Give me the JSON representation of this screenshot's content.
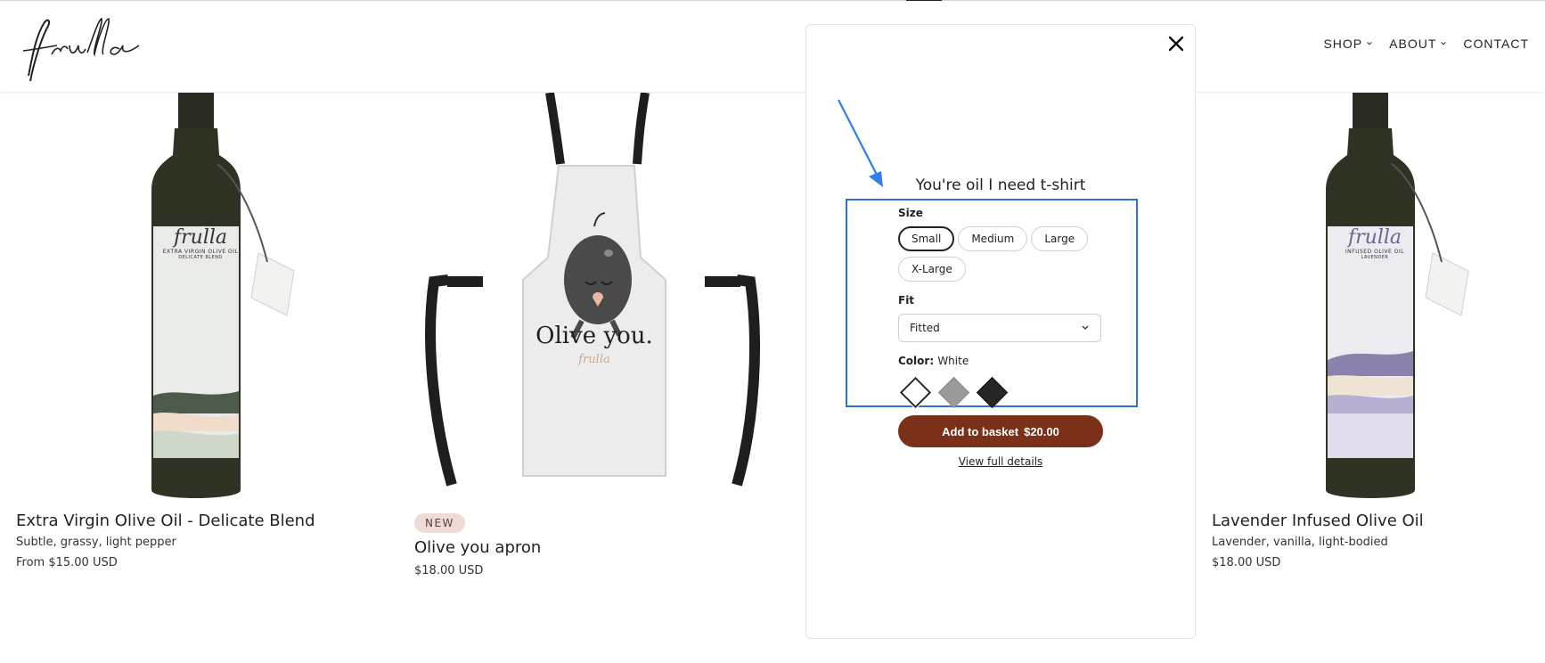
{
  "header": {
    "logo_text": "frulla",
    "nav": [
      {
        "label": "SHOP"
      },
      {
        "label": "ABOUT"
      },
      {
        "label": "CONTACT"
      }
    ]
  },
  "products": [
    {
      "title": "Extra Virgin Olive Oil - Delicate Blend",
      "subtitle": "Subtle, grassy, light pepper",
      "price": "From $15.00 USD",
      "label_brand": "frulla",
      "label_line1": "EXTRA VIRGIN OLIVE OIL",
      "label_line2": "DELICATE BLEND"
    },
    {
      "badge": "NEW",
      "title": "Olive you apron",
      "price": "$18.00 USD",
      "print_text": "Olive you.",
      "print_brand": "frulla"
    },
    {
      "title": "Lavender Infused Olive Oil",
      "subtitle": "Lavender, vanilla, light-bodied",
      "price": "$18.00 USD",
      "label_brand": "frulla",
      "label_line1": "INFUSED OLIVE OIL",
      "label_line2": "LAVENDER"
    }
  ],
  "modal": {
    "title": "You're oil I need t-shirt",
    "size_label": "Size",
    "sizes": [
      "Small",
      "Medium",
      "Large",
      "X-Large"
    ],
    "selected_size": "Small",
    "fit_label": "Fit",
    "fit_value": "Fitted",
    "color_label": "Color:",
    "color_value": "White",
    "swatches": [
      {
        "name": "White",
        "hex": "#ffffff"
      },
      {
        "name": "Grey",
        "hex": "#9a9a9a"
      },
      {
        "name": "Black",
        "hex": "#262626"
      }
    ],
    "add_label": "Add to basket",
    "add_price": "$20.00",
    "details_label": "View full details"
  },
  "colors": {
    "button": "#7b3019",
    "highlight": "#2f6fde",
    "badge_bg": "#eedbd5"
  }
}
